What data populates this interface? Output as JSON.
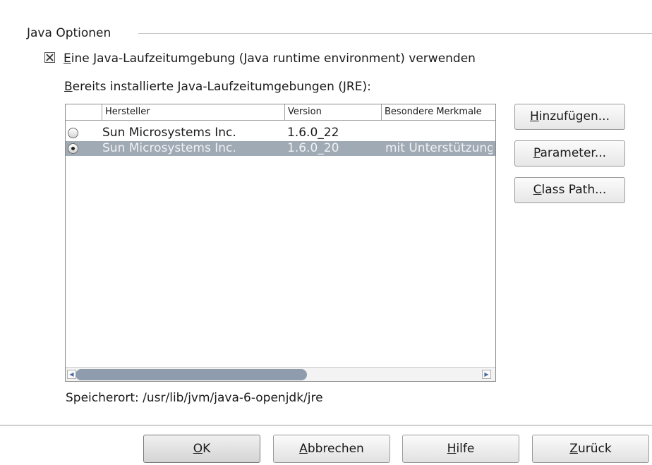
{
  "group": {
    "title": "Java Optionen"
  },
  "use_jre": {
    "checked": true,
    "mnemonic": "E",
    "rest": "ine Java-Laufzeitumgebung (Java runtime environment) verwenden"
  },
  "installed": {
    "mnemonic": "B",
    "rest": "ereits installierte Java-Laufzeitumgebungen (JRE):"
  },
  "table": {
    "columns": [
      "",
      "Hersteller",
      "Version",
      "Besondere Merkmale"
    ],
    "rows": [
      {
        "selected": false,
        "vendor": "Sun Microsystems Inc.",
        "version": "1.6.0_22",
        "features": ""
      },
      {
        "selected": true,
        "vendor": "Sun Microsystems Inc.",
        "version": "1.6.0_20",
        "features": "mit Unterstützung"
      }
    ]
  },
  "side_buttons": {
    "add": {
      "mnemonic": "H",
      "rest": "inzufügen..."
    },
    "params": {
      "mnemonic": "P",
      "rest": "arameter..."
    },
    "classpath": {
      "mnemonic": "C",
      "rest": "lass Path..."
    }
  },
  "location": {
    "text": "Speicherort: /usr/lib/jvm/java-6-openjdk/jre"
  },
  "buttons": {
    "ok": {
      "mnemonic": "O",
      "rest": "K"
    },
    "cancel": {
      "mnemonic": "A",
      "rest": "bbrechen"
    },
    "help": {
      "mnemonic": "H",
      "rest": "ilfe"
    },
    "back": {
      "mnemonic": "Z",
      "rest": "urück"
    }
  }
}
